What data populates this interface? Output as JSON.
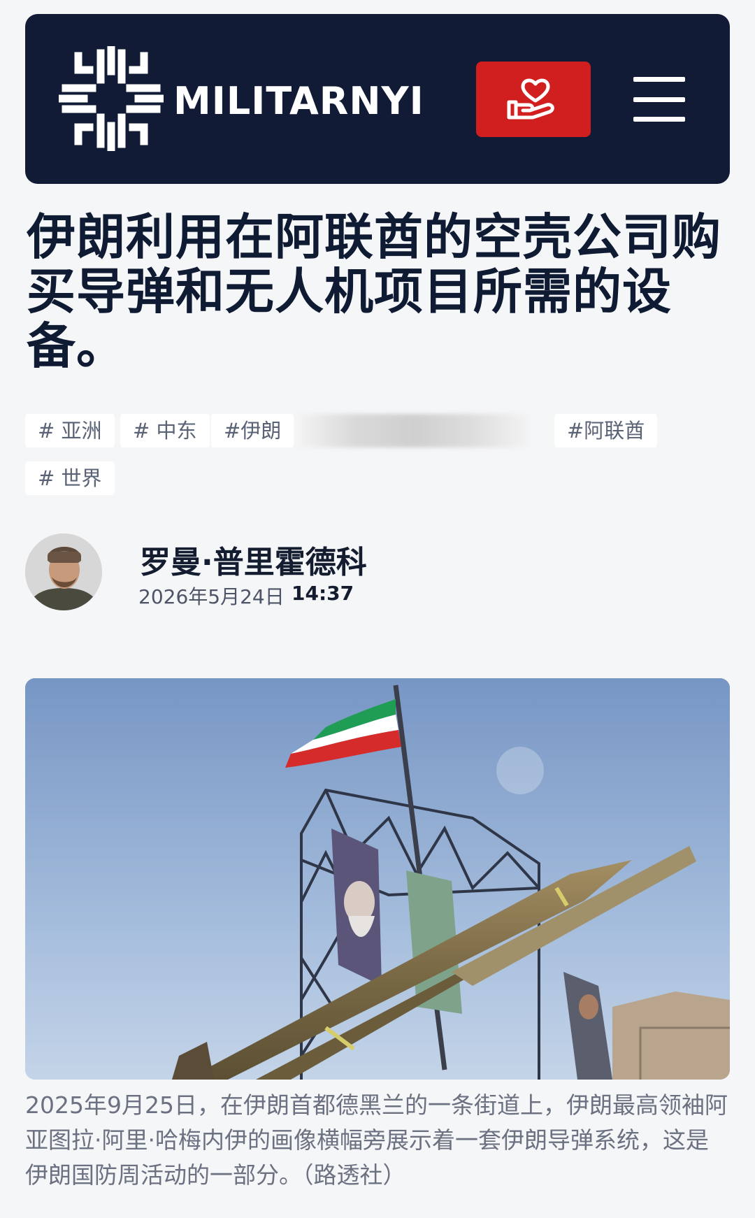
{
  "header": {
    "logo_text": "MILITARNYI",
    "logo_icon": "militarnyi-logo-icon",
    "donate_icon": "heart-hand-icon",
    "menu_icon": "hamburger-menu-icon",
    "colors": {
      "background": "#121b35",
      "donate": "#d11f1f"
    }
  },
  "article": {
    "title": "伊朗利用在阿联酋的空壳公司购买导弹和无人机项目所需的设备。",
    "tags": [
      {
        "label": "# 亚洲"
      },
      {
        "label": "# 中东"
      },
      {
        "label": "#伊朗"
      },
      {
        "label": ""
      },
      {
        "label": "#阿联酋"
      },
      {
        "label": "# 世界"
      }
    ],
    "author": {
      "name": "罗曼·普里霍德科"
    },
    "date": "2026年5月24日",
    "time": "14:37",
    "photo_caption": "2025年9月25日，在伊朗首都德黑兰的一条街道上，伊朗最高领袖阿亚图拉·阿里·哈梅内伊的画像横幅旁展示着一套伊朗导弹系统，这是伊朗国防周活动的一部分。（路透社）"
  }
}
